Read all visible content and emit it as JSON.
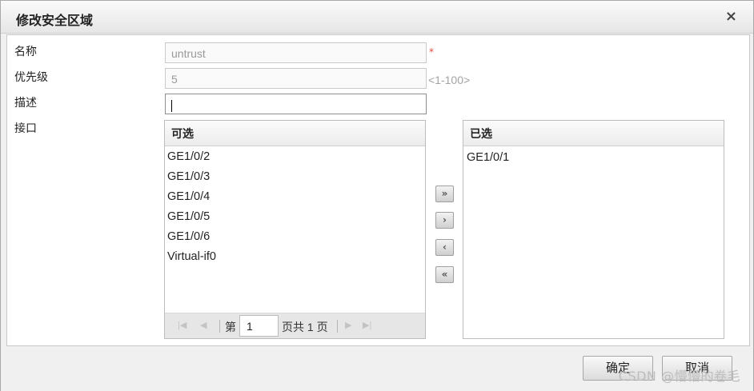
{
  "dialog": {
    "title": "修改安全区域",
    "close_glyph": "×"
  },
  "form": {
    "name_label": "名称",
    "name_value": "untrust",
    "required_mark": "*",
    "priority_label": "优先级",
    "priority_value": "5",
    "priority_hint": "<1-100>",
    "desc_label": "描述",
    "desc_value": "",
    "iface_label": "接口"
  },
  "available": {
    "header": "可选",
    "items": [
      "GE1/0/2",
      "GE1/0/3",
      "GE1/0/4",
      "GE1/0/5",
      "GE1/0/6",
      "Virtual-if0"
    ]
  },
  "selected": {
    "header": "已选",
    "items": [
      "GE1/0/1"
    ]
  },
  "pager": {
    "prefix": "第",
    "page_value": "1",
    "suffix": "页共 1 页",
    "icons": [
      "first-page-icon",
      "prev-page-icon",
      "next-page-icon",
      "last-page-icon"
    ]
  },
  "move_buttons": {
    "add_all": "»",
    "add": "›",
    "remove": "‹",
    "remove_all": "«"
  },
  "footer": {
    "ok_label": "确定",
    "cancel_label": "取消"
  },
  "watermark": "CSDN @懵懵的卷毛"
}
